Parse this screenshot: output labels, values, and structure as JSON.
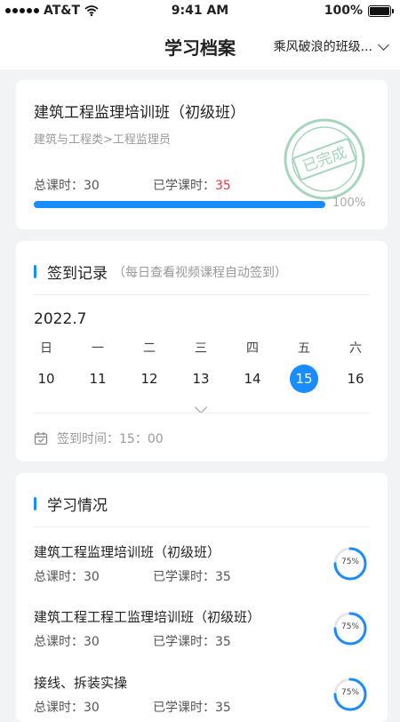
{
  "status_bar": {
    "carrier": "AT&T",
    "time": "9:41 AM",
    "battery": "100%"
  },
  "nav": {
    "title": "学习档案",
    "class_select": "乘风破浪的班级..."
  },
  "course": {
    "title": "建筑工程监理培训班（初级班）",
    "category": "建筑与工程类>工程监理员",
    "total_label": "总课时：30",
    "studied_prefix": "已学课时：",
    "studied_value": "35",
    "progress_text": "100%",
    "progress": 1.0,
    "stamp_text": "已完成"
  },
  "sign": {
    "title": "签到记录",
    "note": "（每日查看视频课程自动签到）",
    "month": "2022.7",
    "weekdays": [
      "日",
      "一",
      "二",
      "三",
      "四",
      "五",
      "六"
    ],
    "dates": [
      "10",
      "11",
      "12",
      "13",
      "14",
      "15",
      "16"
    ],
    "selected_index": 5,
    "sign_time": "签到时间：15：00"
  },
  "study": {
    "title": "学习情况",
    "items": [
      {
        "title": "建筑工程监理培训班（初级班）",
        "total": "总课时：30",
        "studied": "已学课时：35",
        "percent_label": "75%",
        "percent": 0.75
      },
      {
        "title": "建筑工程工程工监理培训班（初级班）",
        "total": "总课时：30",
        "studied": "已学课时：35",
        "percent_label": "75%",
        "percent": 0.75
      },
      {
        "title": "接线、拆装实操",
        "total": "总课时：30",
        "studied": "已学课时：35",
        "percent_label": "75%",
        "percent": 0.75
      }
    ]
  },
  "colors": {
    "accent": "#1a8cff",
    "highlight": "#e4393c",
    "stamp": "#5fb38a"
  }
}
